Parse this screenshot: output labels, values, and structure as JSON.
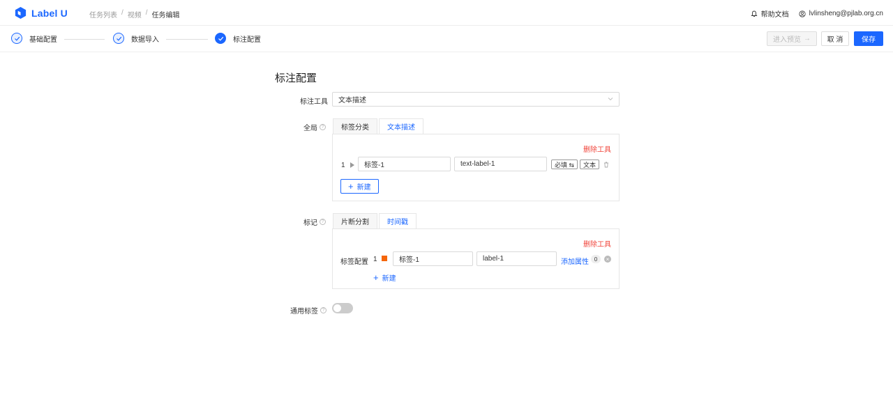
{
  "app": {
    "logo_text": "Label U"
  },
  "breadcrumb": {
    "items": [
      "任务列表",
      "视频",
      "任务编辑"
    ],
    "separator": "/"
  },
  "header": {
    "help_docs": "帮助文档",
    "user_email": "lvlinsheng@pjlab.org.cn"
  },
  "steps": {
    "items": [
      {
        "label": "基础配置",
        "status": "done"
      },
      {
        "label": "数据导入",
        "status": "done"
      },
      {
        "label": "标注配置",
        "status": "active"
      }
    ],
    "preview_button": "进入预览",
    "cancel_button": "取 消",
    "save_button": "保存"
  },
  "form": {
    "title": "标注配置",
    "tool_label": "标注工具",
    "tool_value": "文本描述",
    "global": {
      "label": "全局",
      "tabs": [
        "标签分类",
        "文本描述"
      ],
      "active_tab": "文本描述",
      "delete_tool": "删除工具",
      "row": {
        "index": "1",
        "name": "标签-1",
        "value": "text-label-1",
        "required_button": "必填 ⇆",
        "type_button": "文本"
      },
      "new_button": "新建"
    },
    "mark": {
      "label": "标记",
      "tabs": [
        "片断分割",
        "时间戳"
      ],
      "active_tab": "时间戳",
      "delete_tool": "删除工具",
      "config_label": "标签配置",
      "row": {
        "index": "1",
        "color": "#f5660a",
        "name": "标签-1",
        "value": "label-1",
        "add_attr": "添加属性",
        "count": "0"
      },
      "new_button": "新建"
    },
    "common_label": {
      "label": "通用标签",
      "enabled": false
    }
  },
  "colors": {
    "accent": "#1b67ff",
    "danger": "#f0443a"
  }
}
